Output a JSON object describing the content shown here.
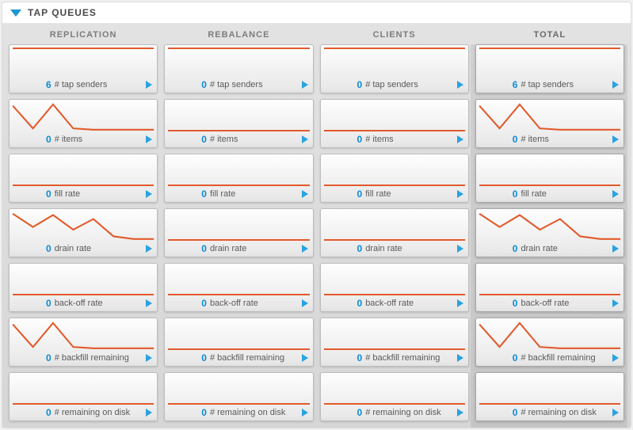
{
  "section_title": "TAP QUEUES",
  "columns": [
    {
      "key": "replication",
      "label": "REPLICATION",
      "selected": false
    },
    {
      "key": "rebalance",
      "label": "REBALANCE",
      "selected": false
    },
    {
      "key": "clients",
      "label": "CLIENTS",
      "selected": false
    },
    {
      "key": "total",
      "label": "TOTAL",
      "selected": true
    }
  ],
  "metrics": [
    {
      "key": "tap_senders",
      "label": "# tap senders"
    },
    {
      "key": "items",
      "label": "# items"
    },
    {
      "key": "fill_rate",
      "label": "fill rate"
    },
    {
      "key": "drain_rate",
      "label": "drain rate"
    },
    {
      "key": "back_off_rate",
      "label": "back-off rate"
    },
    {
      "key": "backfill_remaining",
      "label": "# backfill remaining"
    },
    {
      "key": "remaining_on_disk",
      "label": "# remaining on disk"
    }
  ],
  "cells": {
    "replication": {
      "tap_senders": {
        "value": 6,
        "spark": "top"
      },
      "items": {
        "value": 0,
        "spark": "spikes"
      },
      "fill_rate": {
        "value": 0,
        "spark": "flat"
      },
      "drain_rate": {
        "value": 0,
        "spark": "drop"
      },
      "back_off_rate": {
        "value": 0,
        "spark": "flat"
      },
      "backfill_remaining": {
        "value": 0,
        "spark": "spikes"
      },
      "remaining_on_disk": {
        "value": 0,
        "spark": "flat"
      }
    },
    "rebalance": {
      "tap_senders": {
        "value": 0,
        "spark": "top"
      },
      "items": {
        "value": 0,
        "spark": "flat"
      },
      "fill_rate": {
        "value": 0,
        "spark": "flat"
      },
      "drain_rate": {
        "value": 0,
        "spark": "flat"
      },
      "back_off_rate": {
        "value": 0,
        "spark": "flat"
      },
      "backfill_remaining": {
        "value": 0,
        "spark": "flat"
      },
      "remaining_on_disk": {
        "value": 0,
        "spark": "flat"
      }
    },
    "clients": {
      "tap_senders": {
        "value": 0,
        "spark": "top"
      },
      "items": {
        "value": 0,
        "spark": "flat"
      },
      "fill_rate": {
        "value": 0,
        "spark": "flat"
      },
      "drain_rate": {
        "value": 0,
        "spark": "flat"
      },
      "back_off_rate": {
        "value": 0,
        "spark": "flat"
      },
      "backfill_remaining": {
        "value": 0,
        "spark": "flat"
      },
      "remaining_on_disk": {
        "value": 0,
        "spark": "flat"
      }
    },
    "total": {
      "tap_senders": {
        "value": 6,
        "spark": "top"
      },
      "items": {
        "value": 0,
        "spark": "spikes"
      },
      "fill_rate": {
        "value": 0,
        "spark": "flat"
      },
      "drain_rate": {
        "value": 0,
        "spark": "drop"
      },
      "back_off_rate": {
        "value": 0,
        "spark": "flat"
      },
      "backfill_remaining": {
        "value": 0,
        "spark": "spikes"
      },
      "remaining_on_disk": {
        "value": 0,
        "spark": "flat"
      }
    }
  },
  "chart_data": {
    "type": "line",
    "note": "sparkline mini-charts per cell; values approximate from pixels",
    "series_shapes": {
      "flat": [
        0,
        0,
        0,
        0,
        0,
        0,
        0,
        0
      ],
      "top": [
        1,
        1,
        1,
        1,
        1,
        1,
        1,
        1
      ],
      "spikes": [
        0.9,
        0.05,
        0.95,
        0.05,
        0,
        0,
        0,
        0
      ],
      "drop": [
        0.95,
        0.45,
        0.9,
        0.35,
        0.75,
        0.1,
        0,
        0
      ]
    }
  }
}
